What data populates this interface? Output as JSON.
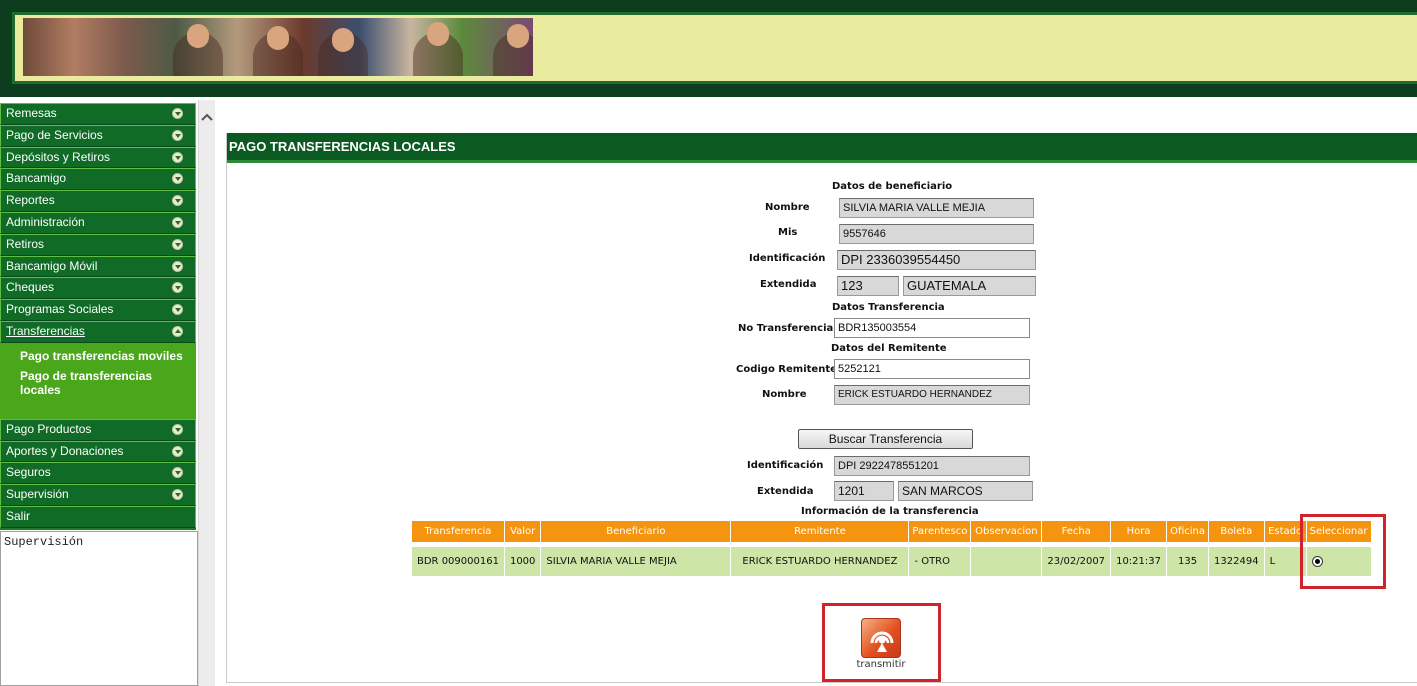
{
  "menu": {
    "items": [
      {
        "label": "Remesas"
      },
      {
        "label": "Pago de Servicios"
      },
      {
        "label": "Depósitos y Retiros"
      },
      {
        "label": "Bancamigo"
      },
      {
        "label": "Reportes"
      },
      {
        "label": "Administración"
      },
      {
        "label": "Retiros"
      },
      {
        "label": "Bancamigo Móvil"
      },
      {
        "label": "Cheques"
      },
      {
        "label": "Programas Sociales"
      },
      {
        "label": "Transferencias"
      }
    ],
    "submenu": [
      "Pago transferencias moviles",
      "Pago de transferencias locales"
    ],
    "items_after": [
      {
        "label": "Pago Productos"
      },
      {
        "label": "Aportes y Donaciones"
      },
      {
        "label": "Seguros"
      },
      {
        "label": "Supervisión"
      },
      {
        "label": "Salir"
      }
    ]
  },
  "supervision_text": "Supervisión",
  "panel": {
    "title": "PAGO TRANSFERENCIAS LOCALES",
    "beneficiary": {
      "section": "Datos de beneficiario",
      "nombre_label": "Nombre",
      "nombre": "SILVIA MARIA VALLE MEJIA",
      "mis_label": "Mis",
      "mis": "9557646",
      "ident_label": "Identificación",
      "ident": "DPI  2336039554450",
      "extendida_label": "Extendida",
      "ext_code": "123",
      "ext_place": "GUATEMALA"
    },
    "transfer": {
      "section": "Datos Transferencia",
      "no_label": "No Transferencia",
      "no": "BDR135003554"
    },
    "sender": {
      "section": "Datos del Remitente",
      "codigo_label": "Codigo Remitente",
      "codigo": "5252121",
      "nombre_label": "Nombre",
      "nombre": "ERICK ESTUARDO HERNANDEZ"
    },
    "search_button": "Buscar Transferencia",
    "sender_id": {
      "ident_label": "Identificación",
      "ident": "DPI   2922478551201",
      "extendida_label": "Extendida",
      "ext_code": "1201",
      "ext_place": "SAN MARCOS"
    },
    "info_section": "Información de la transferencia",
    "table": {
      "headers": [
        "Transferencia",
        "Valor",
        "Beneficiario",
        "Remitente",
        "Parentesco",
        "Observacion",
        "Fecha",
        "Hora",
        "Oficina",
        "Boleta",
        "Estado",
        "Seleccionar"
      ],
      "row": [
        "BDR 009000161",
        "1000",
        "SILVIA MARIA VALLE MEJIA",
        "ERICK ESTUARDO HERNANDEZ",
        "- OTRO",
        "",
        "23/02/2007",
        "10:21:37",
        "135",
        "1322494",
        "L"
      ]
    },
    "transmit_label": "transmitir"
  },
  "colors": {
    "header_bg": "#0b3d1e",
    "menu_bg": "#0f6b26",
    "submenu_bg": "#4aa61a",
    "table_header": "#f4940f",
    "table_row": "#cde6a8",
    "highlight": "#d2232a"
  },
  "icons": {
    "menu_arrow": "chevron-down-icon",
    "scroll_up": "scroll-up-arrow-icon",
    "transmit": "transmit-icon"
  }
}
